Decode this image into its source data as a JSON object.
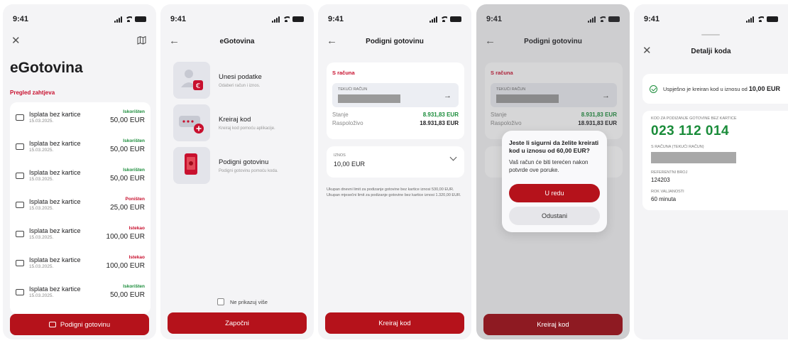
{
  "status": {
    "time": "9:41"
  },
  "screen1": {
    "title": "eGotovina",
    "section": "Pregled zahtjeva",
    "rows": [
      {
        "title": "Isplata bez kartice",
        "date": "15.03.2025.",
        "status": "Iskorišten",
        "amount": "50,00 EUR",
        "color": "#1a8c3a"
      },
      {
        "title": "Isplata bez kartice",
        "date": "15.03.2025.",
        "status": "Iskorišten",
        "amount": "50,00 EUR",
        "color": "#1a8c3a"
      },
      {
        "title": "Isplata bez kartice",
        "date": "15.03.2025.",
        "status": "Iskorišten",
        "amount": "50,00 EUR",
        "color": "#1a8c3a"
      },
      {
        "title": "Isplata bez kartice",
        "date": "15.03.2025.",
        "status": "Poništen",
        "amount": "25,00 EUR",
        "color": "#c8102e"
      },
      {
        "title": "Isplata bez kartice",
        "date": "15.03.2025.",
        "status": "Istekao",
        "amount": "100,00 EUR",
        "color": "#c8102e"
      },
      {
        "title": "Isplata bez kartice",
        "date": "15.03.2025.",
        "status": "Istekao",
        "amount": "100,00 EUR",
        "color": "#c8102e"
      },
      {
        "title": "Isplata bez kartice",
        "date": "15.03.2025.",
        "status": "Iskorišten",
        "amount": "50,00 EUR",
        "color": "#1a8c3a"
      }
    ],
    "button": "Podigni gotovinu"
  },
  "screen2": {
    "title": "eGotovina",
    "options": [
      {
        "title": "Unesi podatke",
        "sub": "Odaberi račun i iznos."
      },
      {
        "title": "Kreiraj kod",
        "sub": "Kreiraj kod pomoću aplikacije."
      },
      {
        "title": "Podigni gotovinu",
        "sub": "Podigni gotovinu pomoću koda."
      }
    ],
    "checkbox": "Ne prikazuj više",
    "button": "Započni"
  },
  "screen3": {
    "title": "Podigni gotovinu",
    "from_label": "S računa",
    "account_label": "TEKUĆI RAČUN",
    "balance_label": "Stanje",
    "balance_value": "8.931,83 EUR",
    "available_label": "Raspoloživo",
    "available_value": "18.931,83 EUR",
    "amount_label": "IZNOS",
    "amount_value": "10,00 EUR",
    "note": "Ukupan dnevni limit za podizanje gotovine bez kartice iznosi 530,00 EUR. Ukupan mjesečni limit za podizanje gotovine bez kartice iznosi 1.320,00 EUR.",
    "button": "Kreiraj kod"
  },
  "screen4": {
    "title": "Podigni gotovinu",
    "from_label": "S računa",
    "account_label": "TEKUĆI RAČUN",
    "balance_label": "Stanje",
    "balance_value": "8.931,83 EUR",
    "available_label": "Raspoloživo",
    "available_value": "18.931,83 EUR",
    "dialog_title": "Jeste li sigurni da želite kreirati kod u iznosu od 60,00 EUR?",
    "dialog_body": "Vaš račun će biti terećen nakon potvrde ove poruke.",
    "ok": "U redu",
    "cancel": "Odustani",
    "button": "Kreiraj kod"
  },
  "screen5": {
    "title": "Detalji koda",
    "success_text": "Uspješno je kreiran kod u iznosu od",
    "success_amount": "10,00 EUR",
    "code_label": "KOD ZA PODIZANJE GOTOVINE BEZ KARTICE",
    "code": "023 112 014",
    "account_label": "S RAČUNA (TEKUĆI RAČUN)",
    "ref_label": "REFERENTNI BROJ",
    "ref_value": "124203",
    "validity_label": "ROK VALJANOSTI",
    "validity_value": "60 minuta"
  }
}
